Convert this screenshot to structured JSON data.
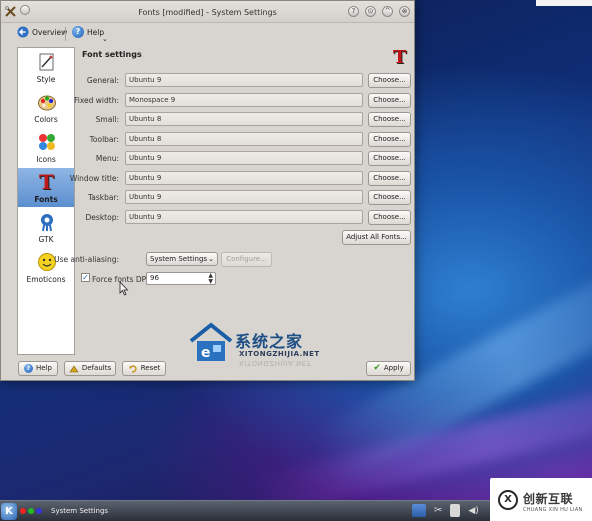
{
  "window": {
    "title": "Fonts [modified] - System Settings",
    "title_buttons": [
      "?",
      "⊙",
      "^",
      "⊗"
    ]
  },
  "toolbar": {
    "overview_label": "Overview",
    "help_label": "Help"
  },
  "sidebar": {
    "items": [
      {
        "label": "Style",
        "icon": "style-icon"
      },
      {
        "label": "Colors",
        "icon": "colors-icon"
      },
      {
        "label": "Icons",
        "icon": "icons-icon"
      },
      {
        "label": "Fonts",
        "icon": "fonts-icon",
        "selected": true
      },
      {
        "label": "GTK",
        "icon": "gtk-icon"
      },
      {
        "label": "Emoticons",
        "icon": "emoticons-icon"
      }
    ]
  },
  "main": {
    "title": "Font settings",
    "rows": [
      {
        "label": "General:",
        "value": "Ubuntu 9",
        "button": "Choose..."
      },
      {
        "label": "Fixed width:",
        "value": "Monospace 9",
        "button": "Choose..."
      },
      {
        "label": "Small:",
        "value": "Ubuntu 8",
        "button": "Choose..."
      },
      {
        "label": "Toolbar:",
        "value": "Ubuntu 8",
        "button": "Choose..."
      },
      {
        "label": "Menu:",
        "value": "Ubuntu 9",
        "button": "Choose..."
      },
      {
        "label": "Window title:",
        "value": "Ubuntu 9",
        "button": "Choose..."
      },
      {
        "label": "Taskbar:",
        "value": "Ubuntu 9",
        "button": "Choose..."
      },
      {
        "label": "Desktop:",
        "value": "Ubuntu 9",
        "button": "Choose..."
      }
    ],
    "adjust_all_label": "Adjust All Fonts...",
    "antialias_label": "Use anti-aliasing:",
    "antialias_value": "System Settings",
    "configure_label": "Configure...",
    "force_dpi_label": "Force fonts DPI:",
    "force_dpi_checked": true,
    "force_dpi_value": "96"
  },
  "footer": {
    "help_label": "Help",
    "defaults_label": "Defaults",
    "reset_label": "Reset",
    "apply_label": "Apply"
  },
  "watermark": {
    "name": "系统之家",
    "site": "XITONGZHIJIA.NET"
  },
  "taskbar": {
    "task_label": "System Settings"
  },
  "corner_brand": {
    "name": "创新互联",
    "sub": "CHUANG XIN HU LIAN"
  },
  "colors": {
    "selection": "#5c8fd0",
    "window_bg": "#d8d4cf",
    "fonts_icon": "#c01818"
  }
}
